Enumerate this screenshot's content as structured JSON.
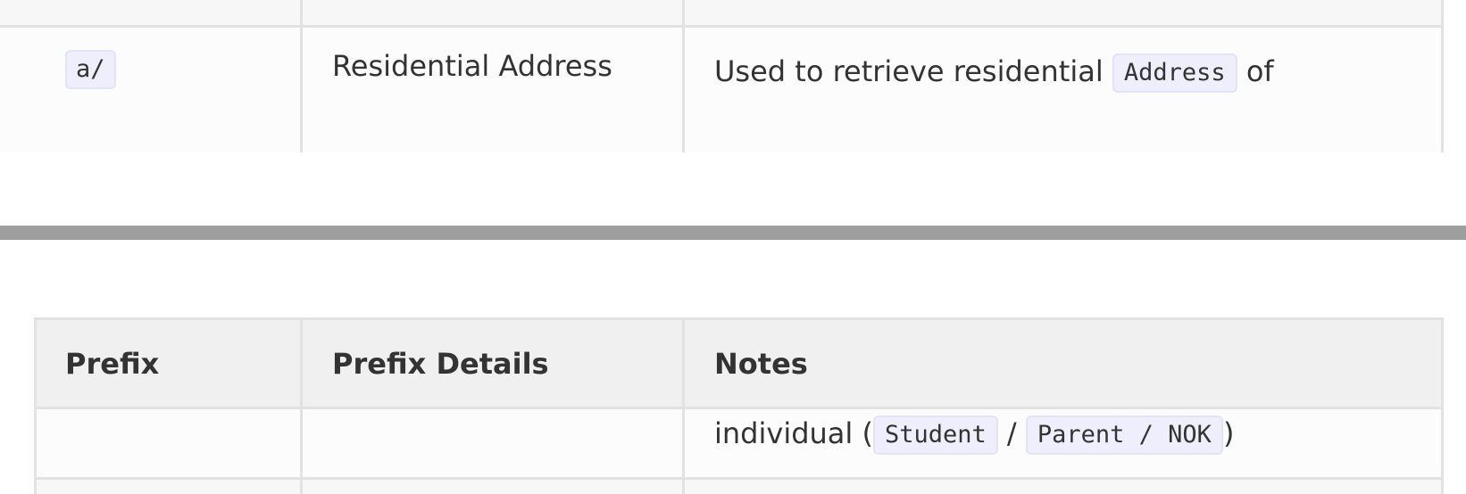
{
  "top_table": {
    "row": {
      "prefix": "a/",
      "details": "Residential Address",
      "notes_prefix": "Used to retrieve residential",
      "notes_code": "Address",
      "notes_suffix": "of"
    }
  },
  "bottom_table": {
    "headers": {
      "prefix": "Prefix",
      "details": "Prefix Details",
      "notes": "Notes"
    },
    "row": {
      "notes_start": "individual (",
      "code_student": "Student",
      "separator": "/",
      "code_parent": "Parent / NOK",
      "notes_end": ")"
    }
  }
}
